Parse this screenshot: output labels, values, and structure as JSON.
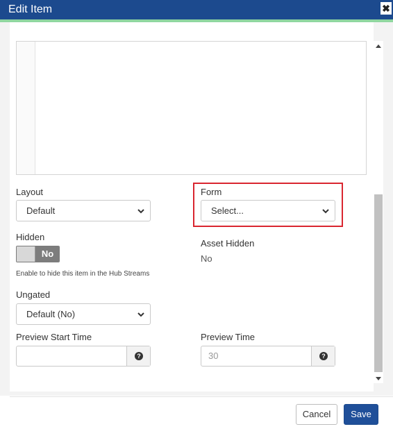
{
  "dialog": {
    "title": "Edit Item",
    "close_label": "✖"
  },
  "fields": {
    "layout": {
      "label": "Layout",
      "value": "Default"
    },
    "form": {
      "label": "Form",
      "value": "Select..."
    },
    "hidden": {
      "label": "Hidden",
      "toggle_state": "No",
      "help": "Enable to hide this item in the Hub Streams"
    },
    "asset_hidden": {
      "label": "Asset Hidden",
      "value": "No"
    },
    "ungated": {
      "label": "Ungated",
      "value": "Default (No)"
    },
    "preview_start_time": {
      "label": "Preview Start Time",
      "value": ""
    },
    "preview_time": {
      "label": "Preview Time",
      "value": "30"
    }
  },
  "footer": {
    "cancel_label": "Cancel",
    "save_label": "Save"
  },
  "colors": {
    "header": "#1c4a8e",
    "accent": "#8fd6a0",
    "highlight": "#d9252f",
    "primary": "#1f4f99"
  },
  "icons": {
    "close": "close-icon",
    "chevron": "chevron-down-icon",
    "help": "question-circle-icon"
  }
}
